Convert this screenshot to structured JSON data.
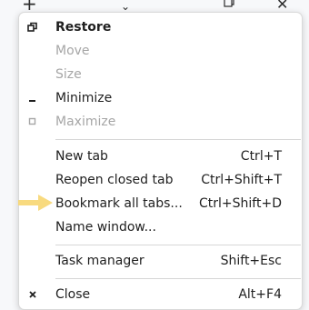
{
  "colors": {
    "menu_bg": "#ffffff",
    "text": "#1f1f1f",
    "disabled_text": "#a6a6a6",
    "separator": "#d6d6d6",
    "highlight_arrow": "#f7d774"
  },
  "titlebar": {
    "new_tab_icon": "plus-icon",
    "tab_search_icon": "chevron-down-icon",
    "restore_icon": "restore-window-icon",
    "close_icon": "close-icon"
  },
  "menu": {
    "items": [
      {
        "label": "Restore",
        "shortcut": "",
        "icon": "restore-icon",
        "state": "bold"
      },
      {
        "label": "Move",
        "shortcut": "",
        "icon": "",
        "state": "disabled"
      },
      {
        "label": "Size",
        "shortcut": "",
        "icon": "",
        "state": "disabled"
      },
      {
        "label": "Minimize",
        "shortcut": "",
        "icon": "minimize-icon",
        "state": "normal"
      },
      {
        "label": "Maximize",
        "shortcut": "",
        "icon": "maximize-icon",
        "state": "disabled"
      },
      {
        "label": "New tab",
        "shortcut": "Ctrl+T",
        "icon": "",
        "state": "normal"
      },
      {
        "label": "Reopen closed tab",
        "shortcut": "Ctrl+Shift+T",
        "icon": "",
        "state": "normal"
      },
      {
        "label": "Bookmark all tabs...",
        "shortcut": "Ctrl+Shift+D",
        "icon": "",
        "state": "normal"
      },
      {
        "label": "Name window...",
        "shortcut": "",
        "icon": "",
        "state": "normal"
      },
      {
        "label": "Task manager",
        "shortcut": "Shift+Esc",
        "icon": "",
        "state": "normal"
      },
      {
        "label": "Close",
        "shortcut": "Alt+F4",
        "icon": "close-icon",
        "state": "normal"
      }
    ]
  }
}
